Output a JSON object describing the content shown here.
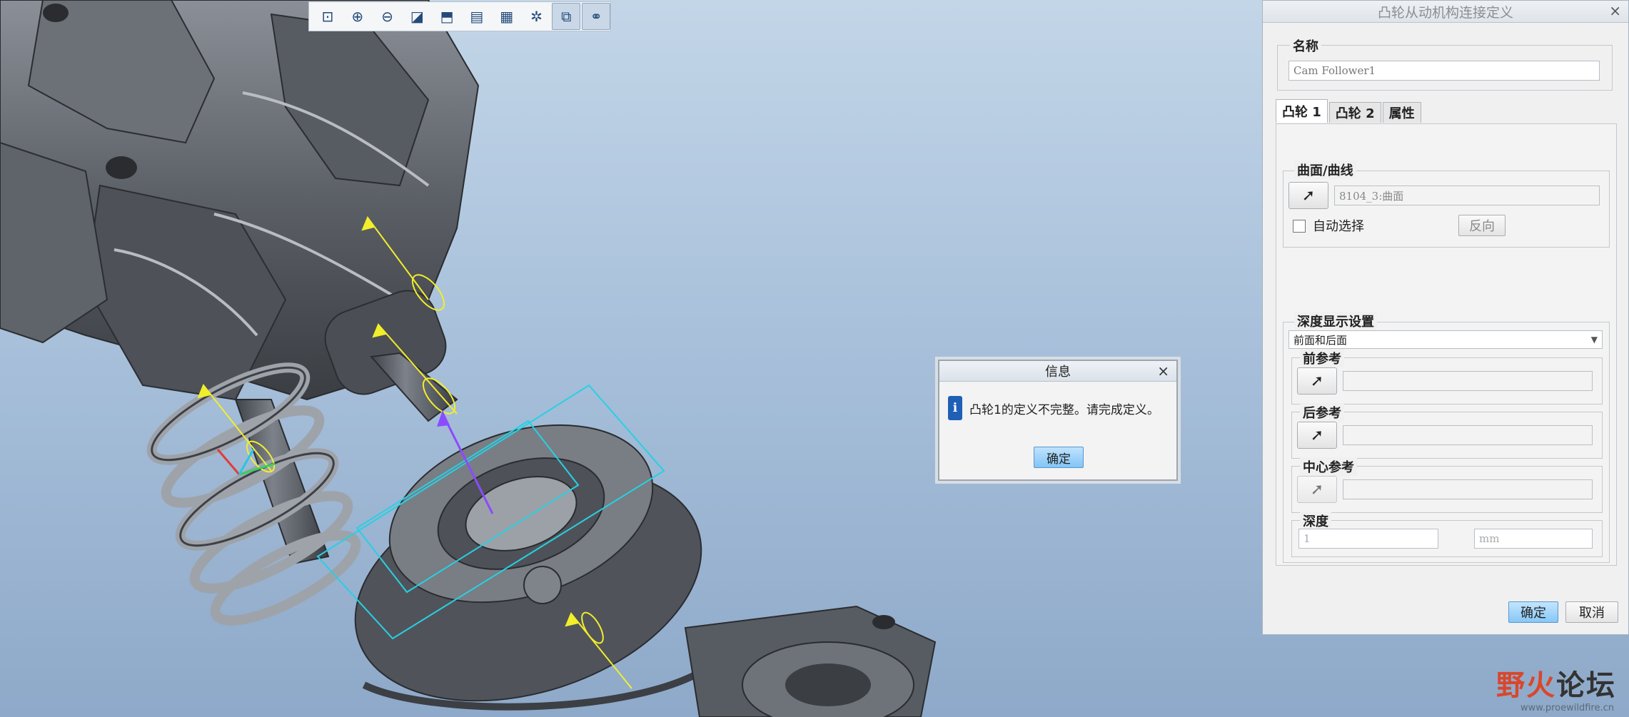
{
  "toolbar": {
    "items": [
      {
        "icon": "refit-icon"
      },
      {
        "icon": "zoom-in-icon"
      },
      {
        "icon": "zoom-out-icon"
      },
      {
        "icon": "repaint-icon"
      },
      {
        "icon": "view-orient-icon"
      },
      {
        "icon": "saved-views-icon"
      },
      {
        "icon": "layers-icon"
      },
      {
        "icon": "datum-display-icon"
      },
      {
        "icon": "mechanism-display-icon"
      },
      {
        "icon": "connections-icon"
      }
    ]
  },
  "info_dialog": {
    "title": "信息",
    "close": "×",
    "icon_letter": "i",
    "message": "凸轮1的定义不完整。请完成定义。",
    "ok_label": "确定"
  },
  "panel": {
    "title": "凸轮从动机构连接定义",
    "close": "×",
    "name_label": "名称",
    "name_value": "Cam Follower1",
    "tabs": [
      "凸轮 1",
      "凸轮 2",
      "属性"
    ],
    "surface_group_label": "曲面/曲线",
    "surface_value": "8104_3:曲面",
    "auto_select_label": "自动选择",
    "reverse_label": "反向",
    "depth_display_label": "深度显示设置",
    "depth_display_value": "前面和后面",
    "front_ref_label": "前参考",
    "back_ref_label": "后参考",
    "center_ref_label": "中心参考",
    "depth_label": "深度",
    "depth_value": "1",
    "depth_unit": "mm",
    "ok_label": "确定",
    "cancel_label": "取消"
  },
  "watermark": {
    "text_red": "野火",
    "text_black": "论坛",
    "url": "www.proewildfire.cn"
  }
}
